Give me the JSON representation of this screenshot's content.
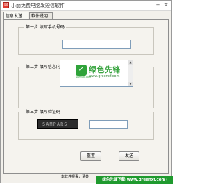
{
  "window": {
    "title": "小丽免费电脑发短信软件",
    "min_glyph": "−",
    "close_glyph": "×"
  },
  "tabs": [
    {
      "label": "信息发送",
      "active": true
    },
    {
      "label": "软件说明",
      "active": false
    }
  ],
  "steps": {
    "phone_label": "第一步 填写手机号码",
    "content_label": "第二步 填写信息内容",
    "code_label": "第三步 填写验证码"
  },
  "fields": {
    "phone_value": "",
    "content_value": "",
    "code_value": ""
  },
  "captcha_text": "SAMPARS",
  "buttons": {
    "reset": "重置",
    "send": "发送"
  },
  "footer_text": "本软件报毒，请关",
  "watermark": {
    "logo_glyph": "✓",
    "logo_caption": "GREENXF.COM",
    "title": "绿色先锋",
    "url": "www.greenxf.com"
  },
  "site_banner": "绿色先锋下载(www.greenxf.com)"
}
